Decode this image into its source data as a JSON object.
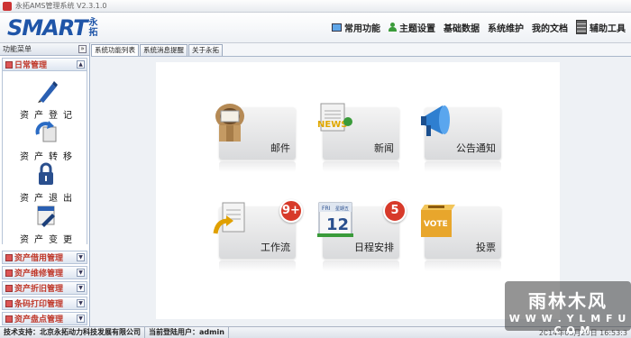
{
  "window": {
    "title": "永拓AMS管理系统 V2.3.1.0"
  },
  "header": {
    "logo_text": "SMART",
    "logo_cn": [
      "永",
      "拓"
    ],
    "nav": [
      {
        "label": "常用功能",
        "icon": "monitor-icon"
      },
      {
        "label": "主题设置",
        "icon": "user-icon"
      },
      {
        "label": "基础数据",
        "icon": ""
      },
      {
        "label": "系统维护",
        "icon": ""
      },
      {
        "label": "我的文档",
        "icon": ""
      },
      {
        "label": "辅助工具",
        "icon": "server-icon"
      }
    ]
  },
  "sidebar": {
    "title": "功能菜单",
    "open_group": "日常管理",
    "items": [
      {
        "label": "资产登记",
        "icon": "pen-icon"
      },
      {
        "label": "资产转移",
        "icon": "transfer-icon"
      },
      {
        "label": "资产退出",
        "icon": "lock-icon"
      },
      {
        "label": "资产变更",
        "icon": "edit-icon"
      }
    ],
    "groups": [
      "资产借用管理",
      "资产维修管理",
      "资产折旧管理",
      "条码打印管理",
      "资产盘点管理"
    ]
  },
  "tabs": [
    {
      "label": "系统功能列表",
      "active": true
    },
    {
      "label": "系统消息提醒",
      "active": false
    },
    {
      "label": "关于永拓",
      "active": false
    }
  ],
  "tiles": [
    {
      "label": "邮件",
      "icon": "mailbox-icon",
      "badge": ""
    },
    {
      "label": "新闻",
      "icon": "news-icon",
      "badge": ""
    },
    {
      "label": "公告通知",
      "icon": "megaphone-icon",
      "badge": ""
    },
    {
      "label": "工作流",
      "icon": "workflow-icon",
      "badge": "9+"
    },
    {
      "label": "日程安排",
      "icon": "calendar-icon",
      "badge": "5"
    },
    {
      "label": "投票",
      "icon": "vote-box-icon",
      "badge": ""
    }
  ],
  "calendar": {
    "weekday": "FRI",
    "date": "12",
    "header_cn": "星期五"
  },
  "news_icon_text": "NEWS",
  "vote_icon_text": "VOTE",
  "statusbar": {
    "support": "技术支持：北京永拓动力科技发展有限公司",
    "user": "当前登陆用户：admin",
    "time": "2014年03月29日 16:53:3"
  },
  "watermark": {
    "line1": "雨林木风",
    "line2": "W W W . Y L M F U . C O M"
  }
}
